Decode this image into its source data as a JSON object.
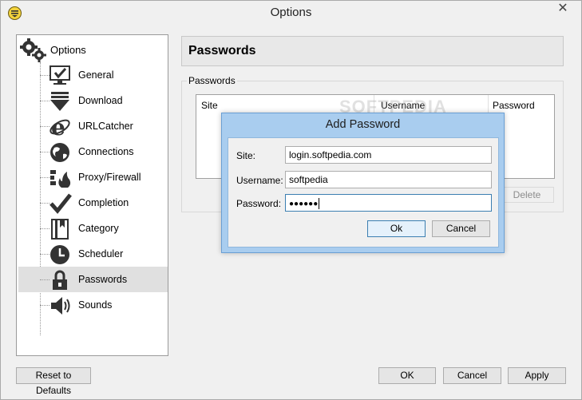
{
  "window": {
    "title": "Options",
    "close_glyph": "✕"
  },
  "tree": {
    "root": {
      "label": "Options",
      "icon": "gears-icon"
    },
    "items": [
      {
        "label": "General",
        "icon": "monitor-check-icon",
        "name": "general"
      },
      {
        "label": "Download",
        "icon": "download-arrow-icon",
        "name": "download"
      },
      {
        "label": "URLCatcher",
        "icon": "ie-logo-icon",
        "name": "urlcatcher"
      },
      {
        "label": "Connections",
        "icon": "globe-icon",
        "name": "connections"
      },
      {
        "label": "Proxy/Firewall",
        "icon": "firewall-icon",
        "name": "proxy-firewall"
      },
      {
        "label": "Completion",
        "icon": "checkmark-icon",
        "name": "completion"
      },
      {
        "label": "Category",
        "icon": "book-icon",
        "name": "category"
      },
      {
        "label": "Scheduler",
        "icon": "clock-icon",
        "name": "scheduler"
      },
      {
        "label": "Passwords",
        "icon": "padlock-icon",
        "name": "passwords",
        "selected": true
      },
      {
        "label": "Sounds",
        "icon": "speaker-icon",
        "name": "sounds"
      }
    ]
  },
  "panel": {
    "header": "Passwords",
    "group_label": "Passwords",
    "columns": [
      "Site",
      "Username",
      "Password"
    ],
    "delete_label": "Delete",
    "watermark": "SOFTPEDIA"
  },
  "dialog": {
    "title": "Add Password",
    "site_label": "Site:",
    "site_value": "login.softpedia.com",
    "username_label": "Username:",
    "username_value": "softpedia",
    "password_label": "Password:",
    "password_value": "●●●●●●",
    "ok_label": "Ok",
    "cancel_label": "Cancel"
  },
  "footer": {
    "reset_label": "Reset to Defaults",
    "ok_label": "OK",
    "cancel_label": "Cancel",
    "apply_label": "Apply"
  }
}
